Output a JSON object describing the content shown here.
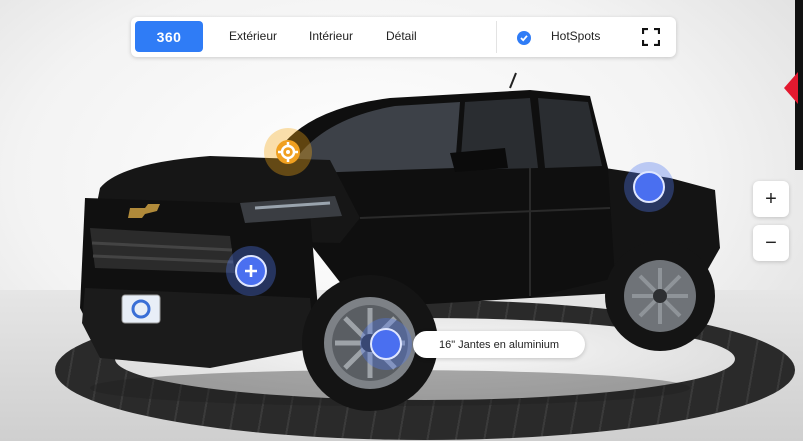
{
  "toolbar": {
    "view_360_label": "360",
    "tabs": [
      {
        "label": "Extérieur"
      },
      {
        "label": "Intérieur"
      },
      {
        "label": "Détail"
      }
    ],
    "hotspots_label": "HotSpots",
    "hotspots_checked": true
  },
  "zoom": {
    "in_symbol": "+",
    "out_symbol": "−"
  },
  "hotspot_tooltip": "16\" Jantes en aluminium",
  "colors": {
    "accent": "#2f7cf6",
    "hotspot_blue": "#4a6ff0",
    "hotspot_orange": "#f0a020",
    "badge_red": "#e3192f"
  },
  "icons": [
    "check-icon",
    "fullscreen-icon",
    "plus-icon",
    "minus-icon",
    "gear-icon"
  ]
}
